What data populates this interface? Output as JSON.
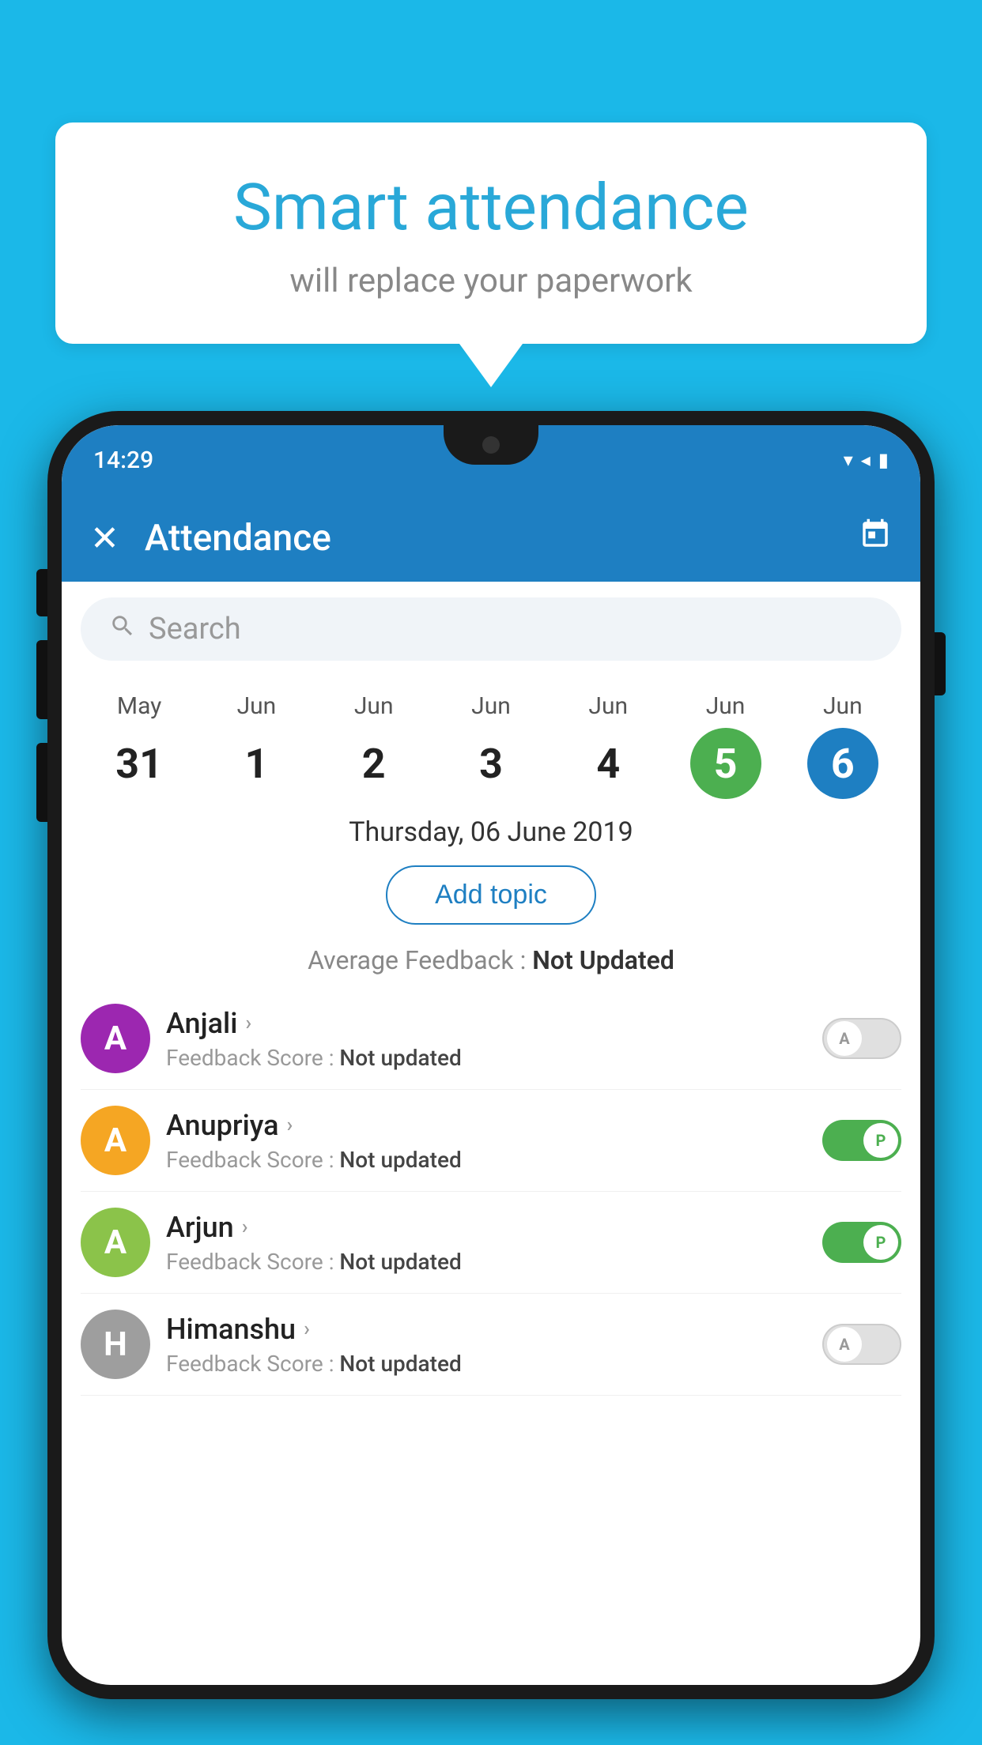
{
  "background_color": "#1bb8e8",
  "speech_bubble": {
    "title": "Smart attendance",
    "subtitle": "will replace your paperwork"
  },
  "status_bar": {
    "time": "14:29",
    "wifi_icon": "▼",
    "signal_icon": "◀",
    "battery_icon": "▮"
  },
  "app_bar": {
    "title": "Attendance",
    "close_label": "✕",
    "calendar_icon": "📅"
  },
  "search": {
    "placeholder": "Search"
  },
  "calendar": {
    "days": [
      {
        "month": "May",
        "date": "31",
        "state": "normal"
      },
      {
        "month": "Jun",
        "date": "1",
        "state": "normal"
      },
      {
        "month": "Jun",
        "date": "2",
        "state": "normal"
      },
      {
        "month": "Jun",
        "date": "3",
        "state": "normal"
      },
      {
        "month": "Jun",
        "date": "4",
        "state": "normal"
      },
      {
        "month": "Jun",
        "date": "5",
        "state": "today"
      },
      {
        "month": "Jun",
        "date": "6",
        "state": "selected"
      }
    ]
  },
  "selected_date_label": "Thursday, 06 June 2019",
  "add_topic_label": "Add topic",
  "avg_feedback_prefix": "Average Feedback : ",
  "avg_feedback_value": "Not Updated",
  "students": [
    {
      "name": "Anjali",
      "avatar_letter": "A",
      "avatar_color": "#9c27b0",
      "feedback_label": "Feedback Score : ",
      "feedback_value": "Not updated",
      "status": "absent"
    },
    {
      "name": "Anupriya",
      "avatar_letter": "A",
      "avatar_color": "#f5a623",
      "feedback_label": "Feedback Score : ",
      "feedback_value": "Not updated",
      "status": "present"
    },
    {
      "name": "Arjun",
      "avatar_letter": "A",
      "avatar_color": "#8bc34a",
      "feedback_label": "Feedback Score : ",
      "feedback_value": "Not updated",
      "status": "present"
    },
    {
      "name": "Himanshu",
      "avatar_letter": "H",
      "avatar_color": "#9e9e9e",
      "feedback_label": "Feedback Score : ",
      "feedback_value": "Not updated",
      "status": "absent"
    }
  ]
}
